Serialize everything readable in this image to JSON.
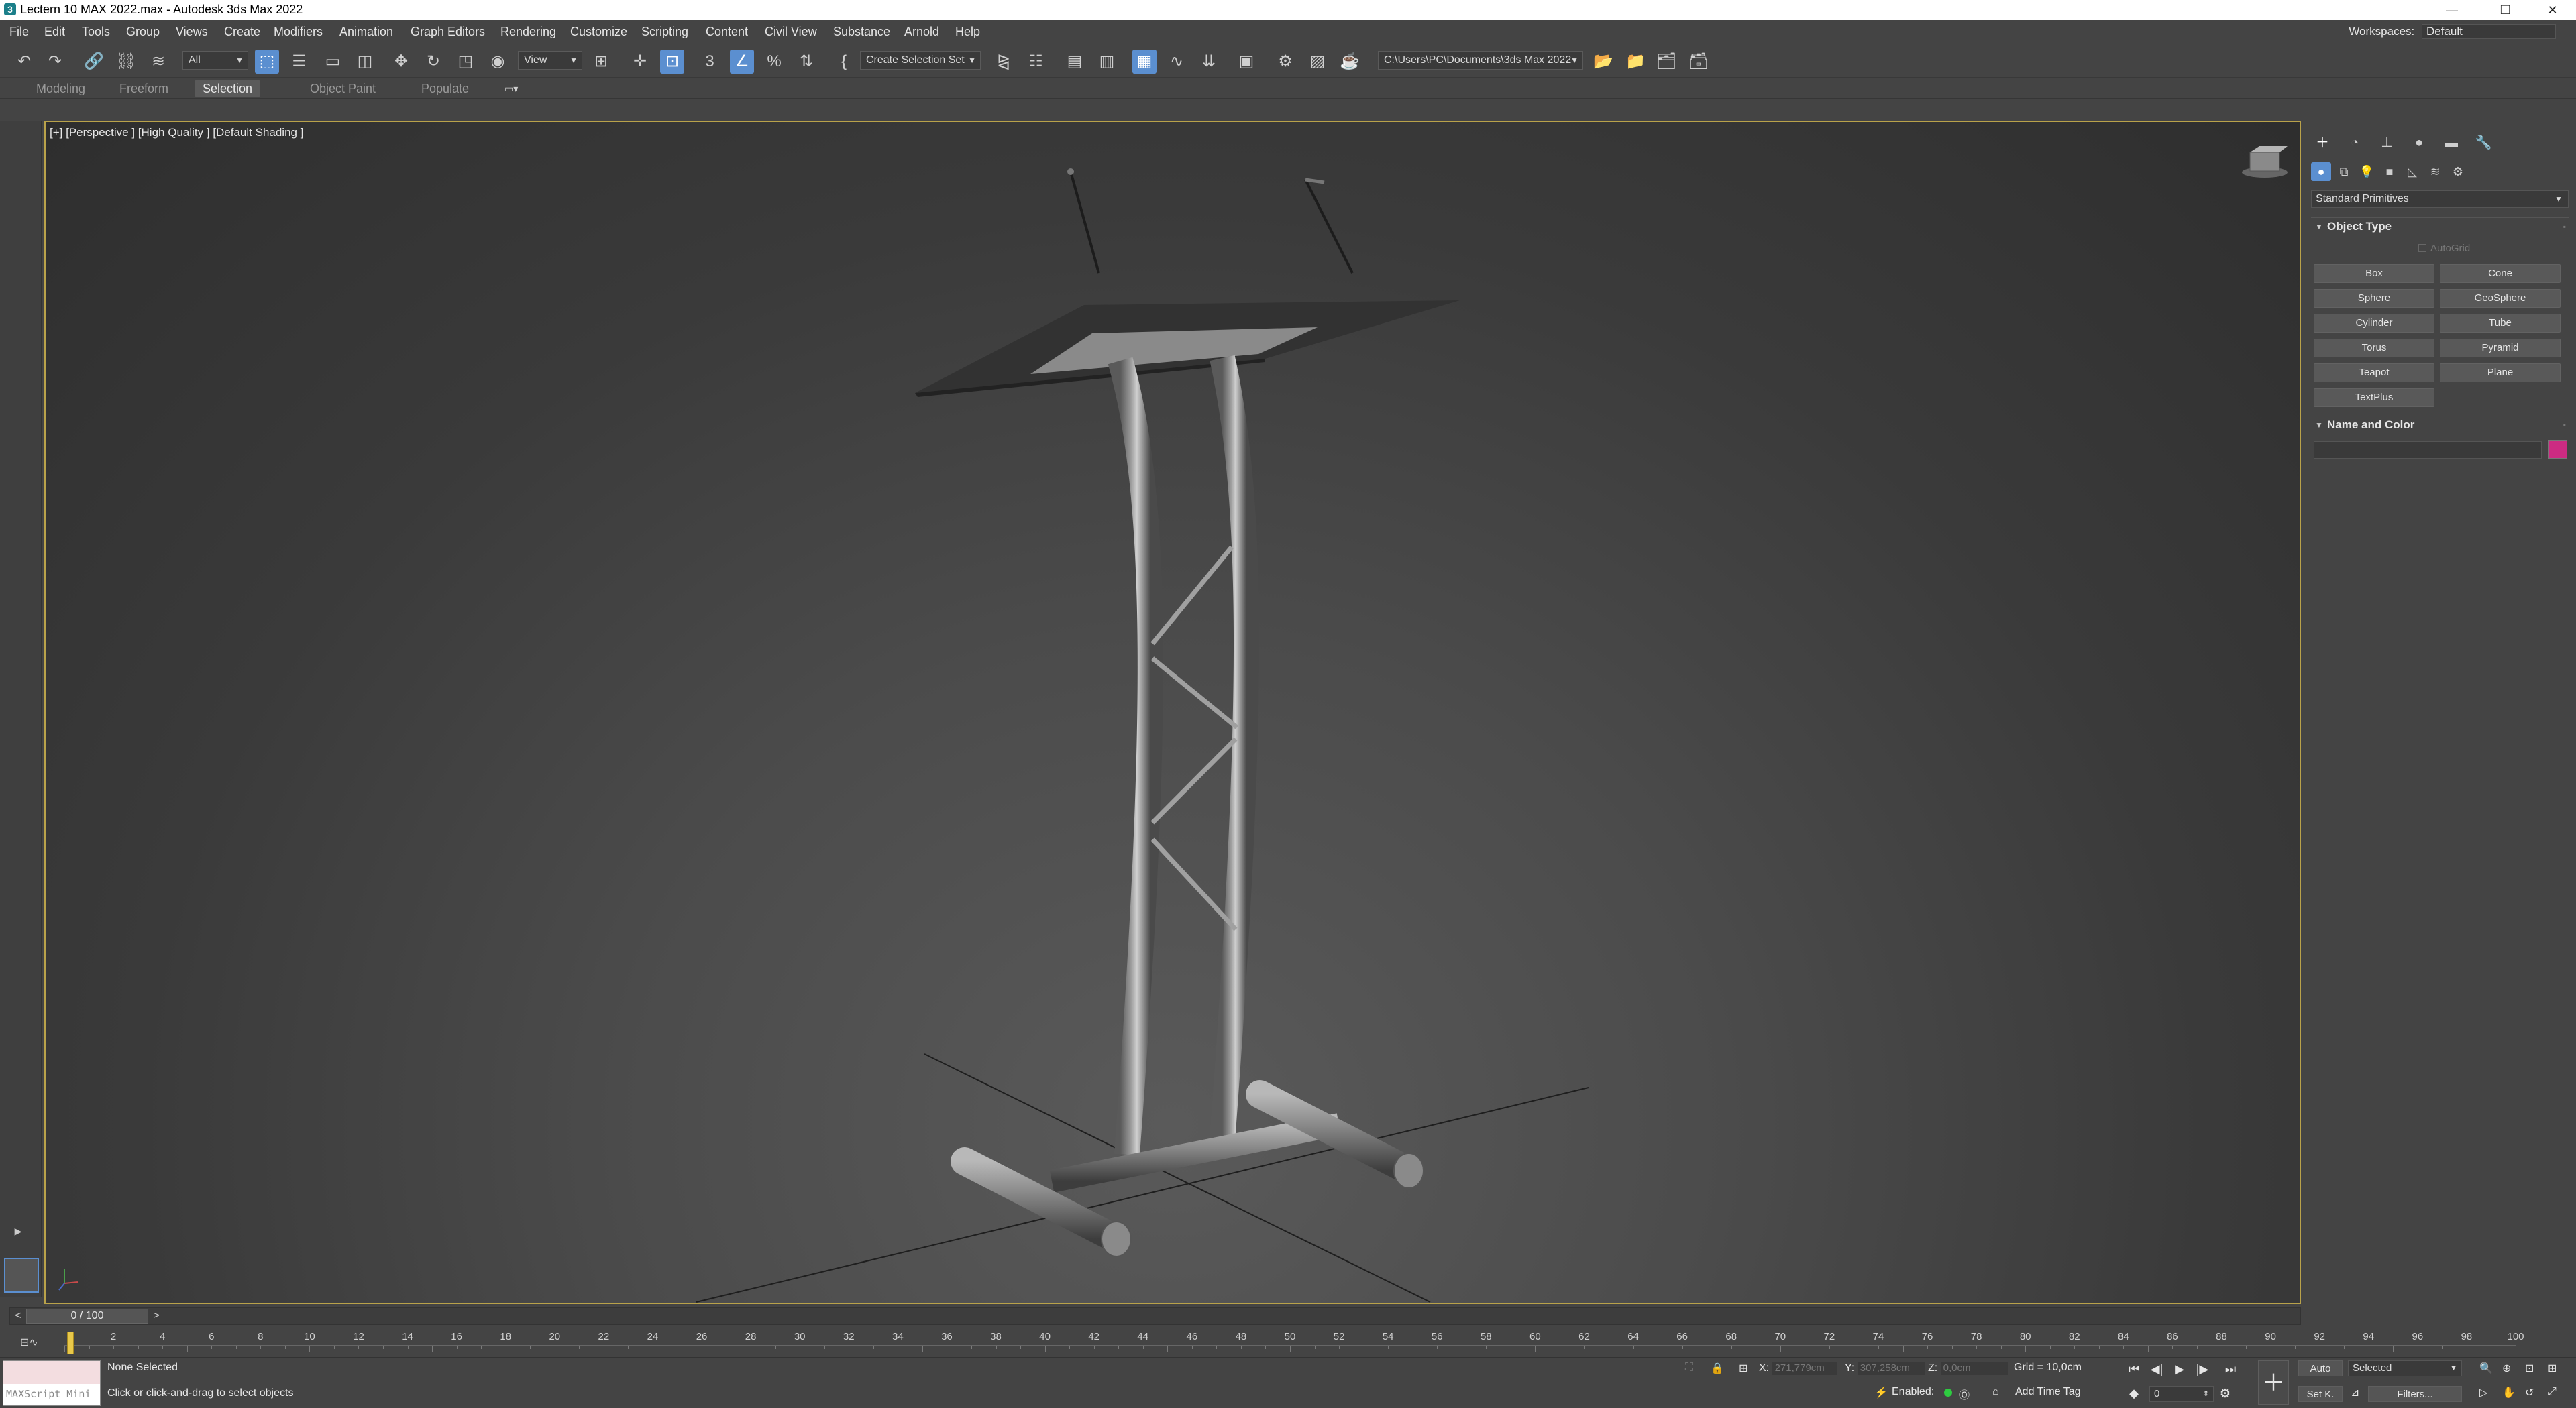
{
  "window": {
    "title": "Lectern 10 MAX 2022.max - Autodesk 3ds Max 2022",
    "controls": [
      "—",
      "❐",
      "✕"
    ]
  },
  "menu": {
    "items": [
      "File",
      "Edit",
      "Tools",
      "Group",
      "Views",
      "Create",
      "Modifiers",
      "Animation",
      "Graph Editors",
      "Rendering",
      "Customize",
      "Scripting",
      "Content",
      "Civil View",
      "Substance",
      "Arnold",
      "Help"
    ],
    "workspaces_label": "Workspaces:",
    "workspaces_value": "Default"
  },
  "toolbar": {
    "filter_value": "All",
    "refcoord_value": "View",
    "selection_set_placeholder": "Create Selection Set",
    "project_path": "C:\\Users\\PC\\Documents\\3ds Max 2022"
  },
  "ribbon": {
    "tabs": [
      "Modeling",
      "Freeform",
      "Selection",
      "Object Paint",
      "Populate"
    ],
    "active_tab": "Selection"
  },
  "viewport": {
    "label": "[+] [Perspective ] [High Quality ] [Default Shading ]"
  },
  "command_panel": {
    "category_value": "Standard Primitives",
    "object_type_title": "Object Type",
    "autogrid_label": "AutoGrid",
    "buttons": [
      "Box",
      "Cone",
      "Sphere",
      "GeoSphere",
      "Cylinder",
      "Tube",
      "Torus",
      "Pyramid",
      "Teapot",
      "Plane",
      "TextPlus"
    ],
    "name_color_title": "Name and Color",
    "object_color": "#cc2b82"
  },
  "timeline": {
    "frame_display": "0 / 100",
    "ticks": [
      0,
      2,
      4,
      6,
      8,
      10,
      12,
      14,
      16,
      18,
      20,
      22,
      24,
      26,
      28,
      30,
      32,
      34,
      36,
      38,
      40,
      42,
      44,
      46,
      48,
      50,
      52,
      54,
      56,
      58,
      60,
      62,
      64,
      66,
      68,
      70,
      72,
      74,
      76,
      78,
      80,
      82,
      84,
      86,
      88,
      90,
      92,
      94,
      96,
      98,
      100
    ],
    "tick_labels": [
      "2",
      "4",
      "6",
      "8",
      "10",
      "12",
      "14",
      "16",
      "18",
      "20",
      "22",
      "24",
      "26",
      "28",
      "30",
      "32",
      "34",
      "36",
      "38",
      "40",
      "42",
      "44",
      "46",
      "48",
      "50",
      "52",
      "54",
      "56",
      "58",
      "60",
      "62",
      "64",
      "66",
      "68",
      "70",
      "72",
      "74",
      "76",
      "78",
      "80",
      "82",
      "84",
      "86",
      "88",
      "90",
      "92",
      "94",
      "96",
      "98",
      "100"
    ]
  },
  "status": {
    "maxscript_label": "MAXScript Mini",
    "selection_status": "None Selected",
    "prompt": "Click or click-and-drag to select objects",
    "x_label": "X:",
    "x_value": "271,779cm",
    "y_label": "Y:",
    "y_value": "307,258cm",
    "z_label": "Z:",
    "z_value": "0,0cm",
    "grid": "Grid = 10,0cm",
    "enabled_label": "Enabled:",
    "add_time_tag": "Add Time Tag",
    "auto_label": "Auto",
    "setkey_label": "Set K.",
    "key_filter_value": "Selected",
    "filters_label": "Filters...",
    "current_frame": "0"
  }
}
